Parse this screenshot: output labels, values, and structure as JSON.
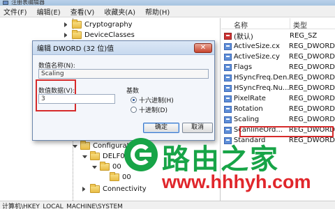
{
  "window": {
    "title": "注册表编辑器"
  },
  "menu": [
    "文件(F)",
    "编辑(E)",
    "查看(V)",
    "收藏夹(A)",
    "帮助(H)"
  ],
  "tree": {
    "items": [
      {
        "label": "Cryptography",
        "expand": "collapsed"
      },
      {
        "label": "DeviceClasses",
        "expand": "collapsed"
      },
      {
        "label": "Configuration",
        "expand": "open"
      },
      {
        "label": "DELF06",
        "expand": "open"
      },
      {
        "label": "00",
        "expand": "open"
      },
      {
        "label": "00",
        "expand": "none"
      },
      {
        "label": "Connectivity",
        "expand": "collapsed"
      }
    ]
  },
  "values_pane": {
    "headers": {
      "name": "名称",
      "type": "类型"
    },
    "rows": [
      {
        "name": "(默认)",
        "type": "REG_SZ",
        "icon": "string-value-icon"
      },
      {
        "name": "ActiveSize.cx",
        "type": "REG_DWORD",
        "icon": "binary-value-icon"
      },
      {
        "name": "ActiveSize.cy",
        "type": "REG_DWORD",
        "icon": "binary-value-icon"
      },
      {
        "name": "Flags",
        "type": "REG_DWORD",
        "icon": "binary-value-icon"
      },
      {
        "name": "HSyncFreq.Den...",
        "type": "REG_DWORD",
        "icon": "binary-value-icon"
      },
      {
        "name": "HSyncFreq.Nu...",
        "type": "REG_DWORD",
        "icon": "binary-value-icon"
      },
      {
        "name": "PixelRate",
        "type": "REG_DWORD",
        "icon": "binary-value-icon"
      },
      {
        "name": "Rotation",
        "type": "REG_DWORD",
        "icon": "binary-value-icon"
      },
      {
        "name": "Scaling",
        "type": "REG_DWORD",
        "icon": "binary-value-icon"
      },
      {
        "name": "ScanlineOrd...",
        "type": "REG_DWORD",
        "icon": "binary-value-icon"
      },
      {
        "name": "Standard",
        "type": "REG_DWORD",
        "icon": "binary-value-icon"
      }
    ]
  },
  "dialog": {
    "title": "编辑 DWORD (32 位)值",
    "close_glyph": "✕",
    "value_name_label": "数值名称(N):",
    "value_name": "Scaling",
    "value_data_label": "数值数据(V):",
    "value_data": "3",
    "base_label": "基数",
    "radio_hex": "十六进制(H)",
    "radio_dec": "十进制(D)",
    "selected_base": "hex",
    "ok_label": "确定",
    "cancel_label": "取消"
  },
  "status_bar": {
    "path": "计算机\\HKEY_LOCAL_MACHINE\\SYSTEM"
  },
  "watermark": {
    "text_cn": "路由之家",
    "url": "www.hhhyh.com"
  },
  "colors": {
    "highlight_red": "#d62a2a",
    "watermark_green": "#17a447",
    "watermark_red": "#e0262b"
  }
}
